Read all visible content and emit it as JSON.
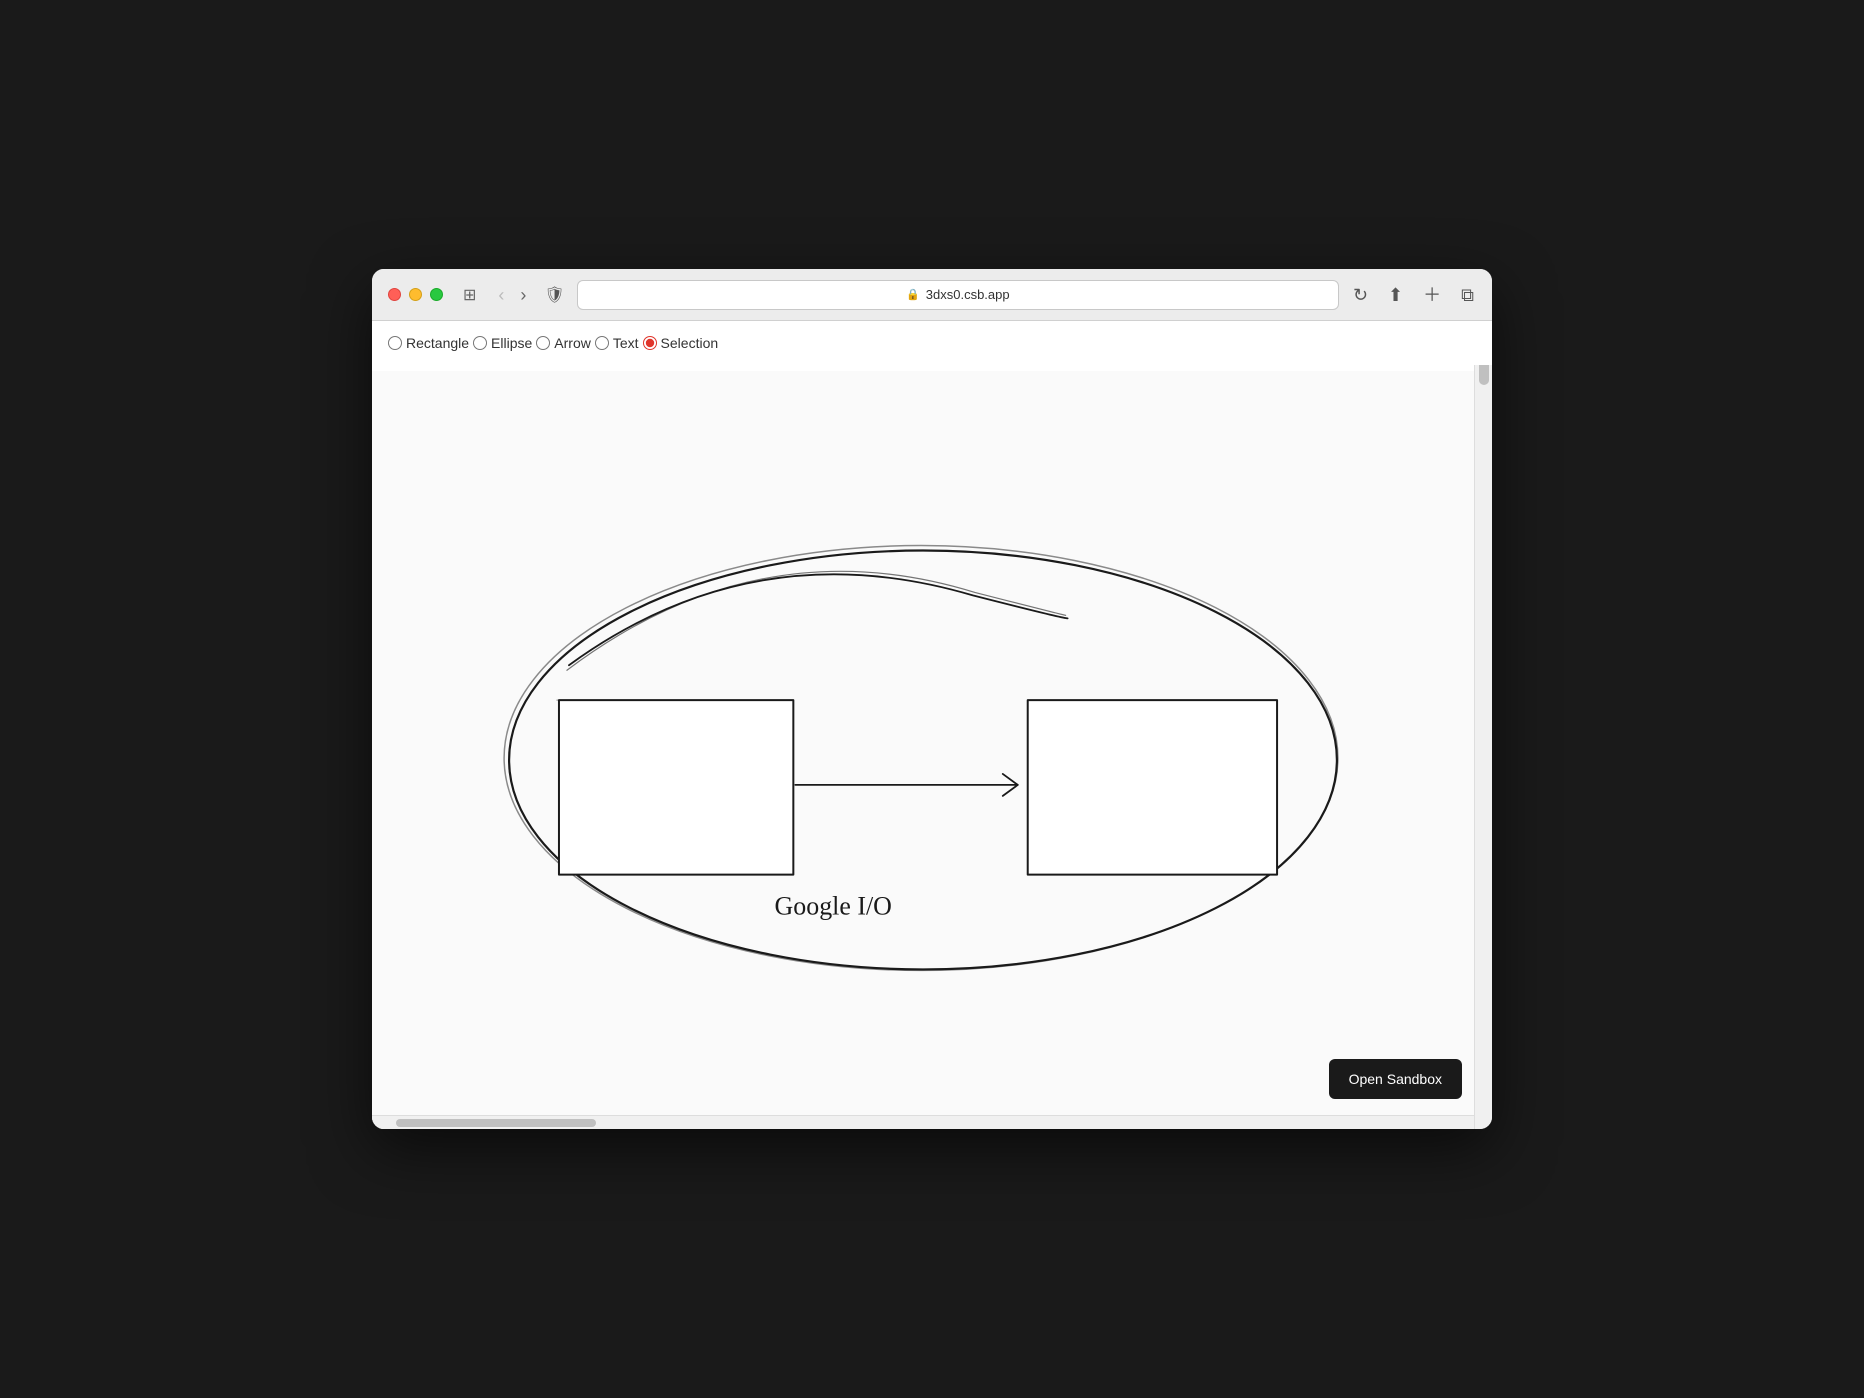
{
  "browser": {
    "url": "3dxs0.csb.app",
    "traffic_lights": {
      "red": "close",
      "yellow": "minimize",
      "green": "maximize"
    }
  },
  "toolbar": {
    "tools": [
      {
        "id": "rectangle",
        "label": "Rectangle",
        "checked": false
      },
      {
        "id": "ellipse",
        "label": "Ellipse",
        "checked": false
      },
      {
        "id": "arrow",
        "label": "Arrow",
        "checked": false
      },
      {
        "id": "text",
        "label": "Text",
        "checked": false
      },
      {
        "id": "selection",
        "label": "Selection",
        "checked": true
      }
    ]
  },
  "canvas": {
    "diagram_label": "Google I/O"
  },
  "open_sandbox": {
    "label": "Open Sandbox"
  }
}
